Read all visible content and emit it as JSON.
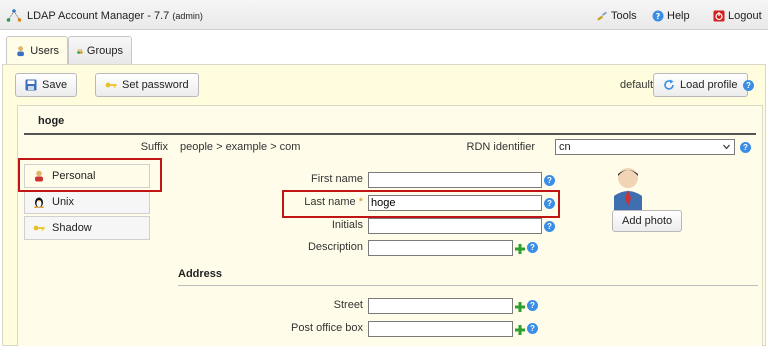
{
  "app": {
    "title": "LDAP Account Manager - 7.7",
    "user_tag": "(admin)"
  },
  "header_links": {
    "tools": "Tools",
    "help": "Help",
    "logout": "Logout"
  },
  "tabs": [
    {
      "label": "Users"
    },
    {
      "label": "Groups"
    }
  ],
  "toolbar": {
    "save": "Save",
    "set_password": "Set password",
    "profile_name": "default",
    "load_profile": "Load profile"
  },
  "account": {
    "title": "hoge",
    "suffix_label": "Suffix",
    "suffix_value": "people > example > com",
    "rdn_label": "RDN identifier",
    "rdn_value": "cn"
  },
  "side_tabs": [
    {
      "label": "Personal"
    },
    {
      "label": "Unix"
    },
    {
      "label": "Shadow"
    }
  ],
  "form": {
    "first_name_label": "First name",
    "first_name_value": "",
    "last_name_label": "Last name",
    "last_name_required": "*",
    "last_name_value": "hoge",
    "initials_label": "Initials",
    "initials_value": "",
    "description_label": "Description",
    "description_value": "",
    "address_heading": "Address",
    "street_label": "Street",
    "street_value": "",
    "po_box_label": "Post office box",
    "po_box_value": ""
  },
  "photo": {
    "add_photo": "Add photo"
  }
}
